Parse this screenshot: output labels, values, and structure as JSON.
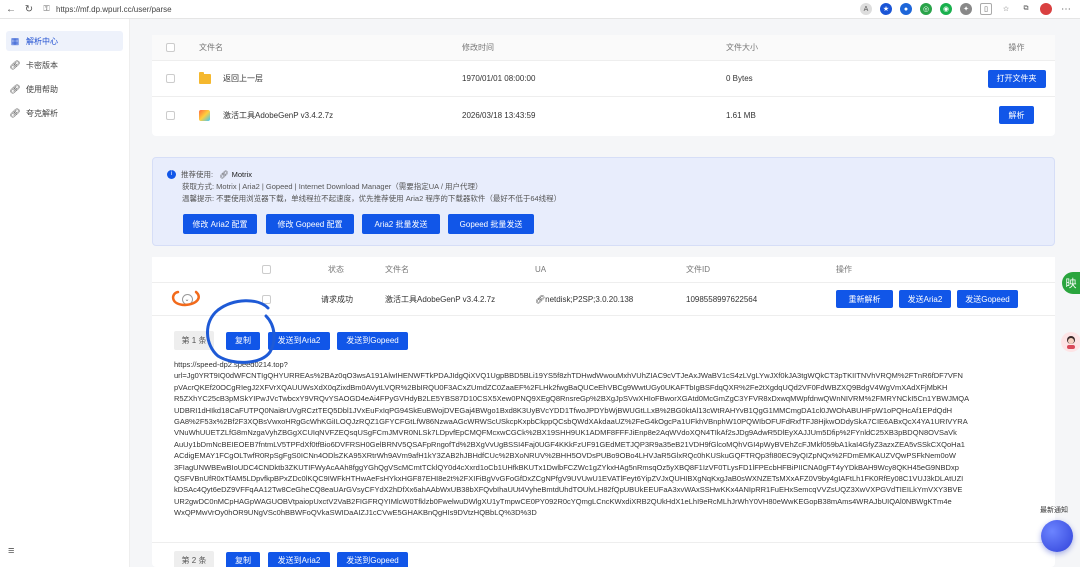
{
  "browser": {
    "url": "https://mf.dp.wpurl.cc/user/parse"
  },
  "sidebar": {
    "items": [
      {
        "label": "解析中心",
        "icon": "grid-icon"
      },
      {
        "label": "卡密版本",
        "icon": "link-icon"
      },
      {
        "label": "使用帮助",
        "icon": "link-icon"
      },
      {
        "label": "夸克解析",
        "icon": "link-icon"
      }
    ]
  },
  "files": {
    "headers": [
      "文件名",
      "修改时间",
      "文件大小",
      "操作"
    ],
    "rows": [
      {
        "name": "返回上一层",
        "time": "1970/01/01 08:00:00",
        "size": "0 Bytes",
        "action": "打开文件夹"
      },
      {
        "name": "激活工具AdobeGenP v3.4.2.7z",
        "time": "2026/03/18 13:43:59",
        "size": "1.61 MB",
        "action": "解析"
      }
    ]
  },
  "info": {
    "recommend_label": "推荐使用:",
    "recommend_value": "Motrix",
    "method_line": "获取方式: Motrix | Aria2 | Gopeed | Internet Download Manager（需要指定UA / 用户代理）",
    "tip_line": "温馨提示: 不要使用浏览器下载，单线程拉不起速度，优先推荐使用 Aria2 程序的下载器软件（最好不低于64线程）",
    "buttons": [
      "修改 Aria2 配置",
      "修改 Gopeed 配置",
      "Aria2 批量发送",
      "Gopeed 批量发送"
    ]
  },
  "results": {
    "headers": [
      "状态",
      "文件名",
      "UA",
      "文件ID",
      "操作"
    ],
    "row": {
      "status": "请求成功",
      "name": "激活工具AdobeGenP v3.4.2.7z",
      "ua": "netdisk;P2SP;3.0.20.138",
      "file_id": "1098558997622564",
      "actions": [
        "重新解析",
        "发送Aria2",
        "发送Gopeed"
      ]
    },
    "items": [
      {
        "index_label": "第 1 条",
        "buttons": [
          "复制",
          "发送到Aria2",
          "发送到Gopeed"
        ],
        "link_lines": [
          "https://speed-dp2.speed0214.top?",
          "url=Jg0YRT9IQ0dWFCNTIgQHYURREAs%2BAz0qO3wsA191AlwIHENWFTkPDAJIdgQiXVQ1UgpBBD5BLi19YS5f8zhTDHwdWwouMxhVUhZIAC9cVTJeAxJWaBV1cS4zLVgLYwJXf0kJA3tgWQkCT3pTKIITNVhVRQM%2FTnR6fDF7VFN",
          "pVAcrQKEf20OCgRIegJ2XFVrXQAUUWsXdX0qZixdBm0AVytLVQR%2BbIRQU0F3ACxZUmdZC0ZaaEF%2FLHk2fwgBaQUCeEhVBCg9WwtUGy0UKAFTbIgBSFdqQXR%2Fe2tXgdqUQd2VF0FdWBZXQ9BdgV4WgVmXAdXFjMbKH",
          "R5ZXhYC25cB3pMSkYIPwJVcTwbcxY9VRQvYSAOGD4eAi4FPyGVHdyB2LE5YBS87D10CSX5Xew0PNQ9XEgQ8RnsreGp%2BXgJpSVwXHIoFBworXGAtd0McGmZgC3YFVR8xDxwqMWpfdnwQWnNIVRM%2FMRYNCkI5Cn1YBWJMQA",
          "UDBRI1dHIkd18CaFUTPQ0Nai8rUVgRCztTEQ5Dbl1JVxEuFxIqPG94SkEuBWojDVEGaj4BWgo1Bxd8K3UyBVcYDD1TfwoJPDYbWjBWUGtLLxB%2BG0ktAl13cWtRAHYvB1QgG1MMCmgDA1cl0JWOhABUHFpW1oPQHcAf1EPdQdH",
          "GA8%2F53x%2Bf2F3XQBsVwxoHRgGcWhKGiILOQJzRQZ1GFYCFGtLfW86NzwaAGcWRWScUSkcpKxpbCkppQCsbQWdXAkdaaUZ%2FeG4kOgcPa1UFkhVBnphW10PQWIbOFUFdRxfTFJ8HjkwODdySkA7CIE6ABxQcX4YA1URIVYRA",
          "VNuWhUUETZLfG8mNzgaVyhZBGgXCUIqNVFZEQsqUSgFCmJMVR0NLSk7LDpvfEpCMQFMcxwCGCk%2BX19SHH9UK1ADMF8FFFJiEnp8e2AqWVdoXQN4TIkAf2sJDg9AdwR5DlEyXAJJUm5Dfip%2FYnldC25XB3pBDQN8OVSaVk",
          "AuUy1bDmNcBEIEOEB7fntmLV5TPFdXf0tfBio6DVFRSH0GelBRNV5QSAFpRngofTd%2BXgVvUgBSSI4Faj0UGF4KKkFzUF91GEdMETJQP3R9a35eB21VDH9fGlcoMQhVGI4pWyBVEhZcFJMkf059bA1kaI4GfyZ3azxZEA5vSSkCXQoHa1",
          "ACdigEMAY1FCgOLTwfR0RpSgFgS0ICNn4ODlsZKA95XRtrWh9AVm9afH1kY3ZAB2hJBHdfCUc%2BXoNRUV%2BHH5OVDsPUBo9OBo4LHVJaR5GlxRQc0hKUSkuGQFTRQp3fI80EC9yQIZpNQx%2FDmEMKAUZVQwPSFkNem0oW",
          "3FIagUNWBEwBIoUDC4CNDktb3ZKUTIFWyAcAAh8fggYGhQgVScMCmtTCklQY0d4cXxrd1oCb1UHfkBKUTx1DwlbFCZWc1gZYkxHAg5nRmsqOz5yXBQ8F1IzVF0TLysFD1lFPEcbHFBiPIICNA0gFT4yYDkBAH9Wcy8QKH45eG9NBDxp",
          "QSFVBnUfR0xTfAM5LDpvfkpBPxZDc0lKQC9IWFkHTHwAeFsHYkxHGF87EHI8e2t%2FXIFiBgVvGFoGfDxZCgNPfgV9UVUwU1EVATlFeyt6YipZVJxQUHIBXgNqKxgJaB0sWXNZETsMXxAFZ0V9by4gIAFtLh1FK0RfEy08C1VUJ3kDLAtUZI",
          "kDSAc4Qyt6eDZ9VFFqAA12Tw8CeGheCQ8eaUArGVsyCFYdX2hDfXx6ahAAbWxUB38bXFQvbIhaUUt4VyheBmtdUhdTOUlvLH82fQpUBUkEEUFaA3xvWAxSSHwKKx4ANIpRR1FuEHxSemcqVVZsUQZ3XwVXPGVdTIEILkYmVXY3BVE",
          "UR2gwDC0nMCpHAGpWAGUOBVtpaiopUxctV2VaB2FIGFRQYIMlcW0Tfklzb0FwelwuDWlgXU1yTmpwCE0PY092R0cYQmgLCncKWxdiXRB2QUkHdX1eLhI9eRcMLhJrWhY0VH80eWwKEGopB38mAms4WRAJbUIQAl0NBWgKTm4e",
          "WxQPMwVrOy0hOR9UNgVSc0hBBWFoQVkaSWIDaAIZJ1cCVwE5GHAKBnQgHIs9DVtzHQBbLQ%3D%3D"
        ]
      },
      {
        "index_label": "第 2 条",
        "buttons": [
          "复制",
          "发送到Aria2",
          "发送到Gopeed"
        ]
      }
    ]
  },
  "floating": {
    "side_badge": "映",
    "notice_label": "最新通知"
  },
  "colors": {
    "primary": "#1156e8",
    "annotation_orange": "#f26a1b",
    "annotation_blue": "#1e5ad6",
    "info_bg": "#e8edfc"
  }
}
